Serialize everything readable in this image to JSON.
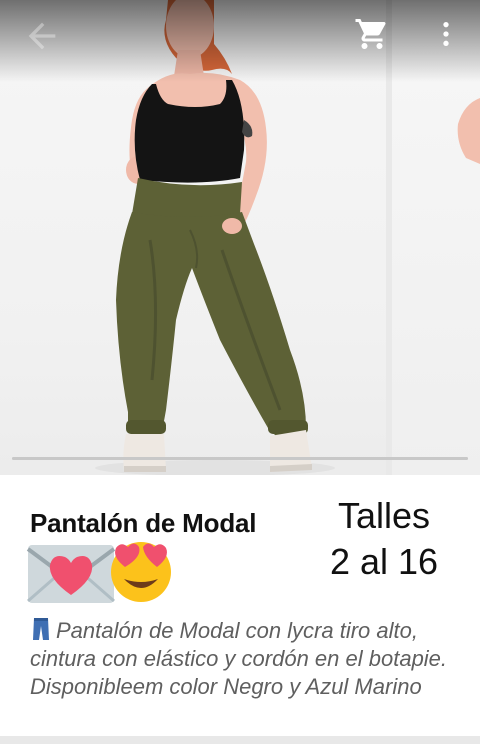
{
  "app_bar": {
    "back_icon": "arrow-back-icon",
    "cart_icon": "shopping-cart-icon",
    "more_icon": "more-vert-icon"
  },
  "gallery": {
    "image_alt": "Modelo con pantalón de modal verde oliva",
    "progress_fraction": 1.0
  },
  "product": {
    "title": "Pantalón de Modal",
    "sizes_line1": "Talles",
    "sizes_line2": "2 al 16",
    "emojis": [
      "love-letter-emoji",
      "heart-eyes-emoji"
    ],
    "description_icon": "jeans-emoji",
    "description": "Pantalón de Modal con lycra tiro alto, cintura con elástico y cordón en el botapie. Disponibleem color Negro y Azul Marino"
  },
  "colors": {
    "pants_olive": "#5d6136",
    "top_black": "#141414",
    "hair_ginger": "#d8683a",
    "skin": "#f2bfae"
  }
}
